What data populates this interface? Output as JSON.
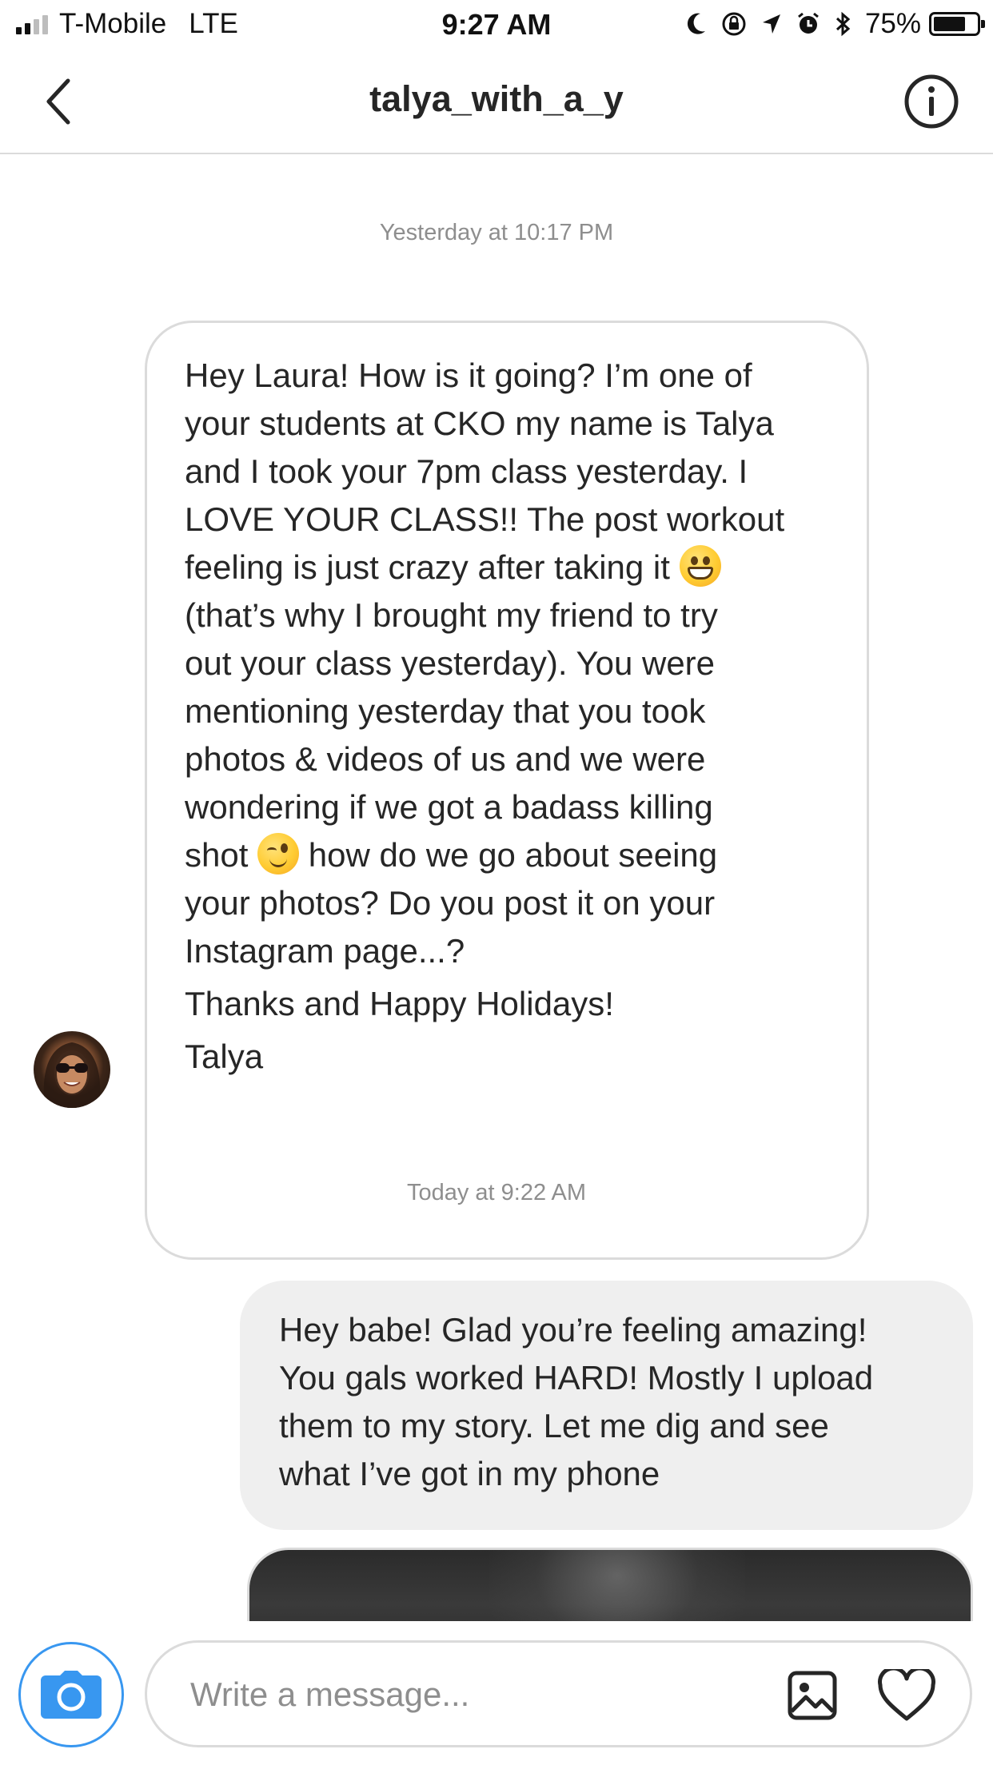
{
  "status_bar": {
    "carrier": "T-Mobile",
    "network": "LTE",
    "time": "9:27 AM",
    "battery_percent": "75%",
    "battery_level": 0.75,
    "icons": [
      "signal-icon",
      "moon-icon",
      "rotation-lock-icon",
      "location-icon",
      "alarm-icon",
      "bluetooth-icon",
      "battery-icon"
    ]
  },
  "header": {
    "title": "talya_with_a_y",
    "back_icon": "chevron-left-icon",
    "info_icon": "info-icon"
  },
  "conversation": {
    "timestamps": [
      "Yesterday at 10:17 PM",
      "Today at 9:22 AM"
    ],
    "incoming": {
      "avatar": "avatar",
      "lines": [
        "Hey Laura! How is it going? I’m one of",
        "your students at CKO my name is Talya",
        "and I took your 7pm class yesterday. I",
        "LOVE YOUR CLASS!! The post workout",
        "feeling is just crazy after taking it",
        "(that’s why I brought my friend to try",
        "out your class yesterday). You were",
        "mentioning yesterday that you took",
        "photos & videos of us and we were",
        "wondering if we got a badass killing",
        "shot",
        "how do we go about seeing",
        "your photos? Do you post it on your",
        "Instagram page...?"
      ],
      "closing": "Thanks and Happy Holidays!",
      "signature": "Talya",
      "emojis": [
        "grinning-face-emoji",
        "winking-face-emoji"
      ]
    },
    "outgoing": {
      "lines": [
        "Hey babe! Glad you’re feeling amazing!",
        "You gals worked HARD! Mostly I upload",
        "them to my story. Let me dig and see",
        "what I’ve got in my phone"
      ]
    },
    "photo_message": "photo-message"
  },
  "composer": {
    "placeholder": "Write a message...",
    "value": "",
    "camera_icon": "camera-icon",
    "gallery_icon": "gallery-icon",
    "like_icon": "heart-icon"
  },
  "colors": {
    "accent": "#3897f0",
    "border": "#dbdbdb",
    "outgoing_bubble": "#efefef",
    "timestamp": "#8e8e8e",
    "text": "#262626"
  }
}
